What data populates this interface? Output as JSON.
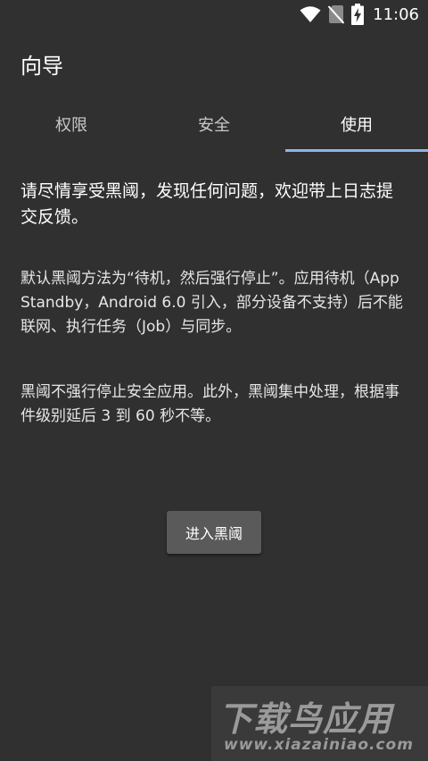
{
  "status_bar": {
    "time": "11:06",
    "icons": [
      "wifi-icon",
      "no-sim-icon",
      "battery-charging-icon"
    ]
  },
  "app_bar": {
    "title": "向导"
  },
  "tabs": [
    {
      "label": "权限",
      "active": false
    },
    {
      "label": "安全",
      "active": false
    },
    {
      "label": "使用",
      "active": true
    }
  ],
  "content": {
    "intro": "请尽情享受黑阈，发现任何问题，欢迎带上日志提交反馈。",
    "paragraph1": "默认黑阈方法为“待机，然后强行停止”。应用待机（App Standby，Android 6.0 引入，部分设备不支持）后不能联网、执行任务（Job）与同步。",
    "paragraph2": "黑阈不强行停止安全应用。此外，黑阈集中处理，根据事件级别延后 3 到 60 秒不等。"
  },
  "button": {
    "label": "进入黑阈"
  },
  "watermark": {
    "title": "下载鸟应用",
    "url": "www.xiazainiao.com"
  },
  "colors": {
    "background": "#303030",
    "tab_indicator": "#90b4e4",
    "button": "#5a5a5a"
  }
}
